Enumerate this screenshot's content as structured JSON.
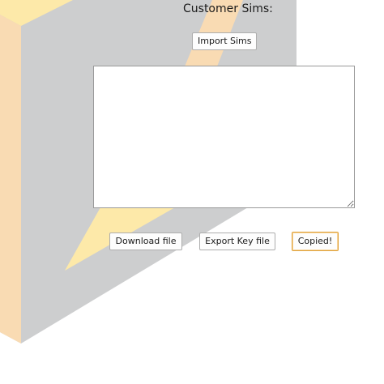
{
  "header": {
    "title": "Customer Sims:"
  },
  "toolbar": {
    "import_label": "Import Sims"
  },
  "editor": {
    "value": "",
    "placeholder": ""
  },
  "actions": {
    "download_label": "Download file",
    "export_label": "Export Key file",
    "copy_label": "Copied!"
  },
  "colors": {
    "panel_gray": "#cdcecf",
    "accent_peach": "#f9dbb3",
    "accent_yellow": "#fde9a9",
    "focus_orange": "#e0a23a"
  }
}
